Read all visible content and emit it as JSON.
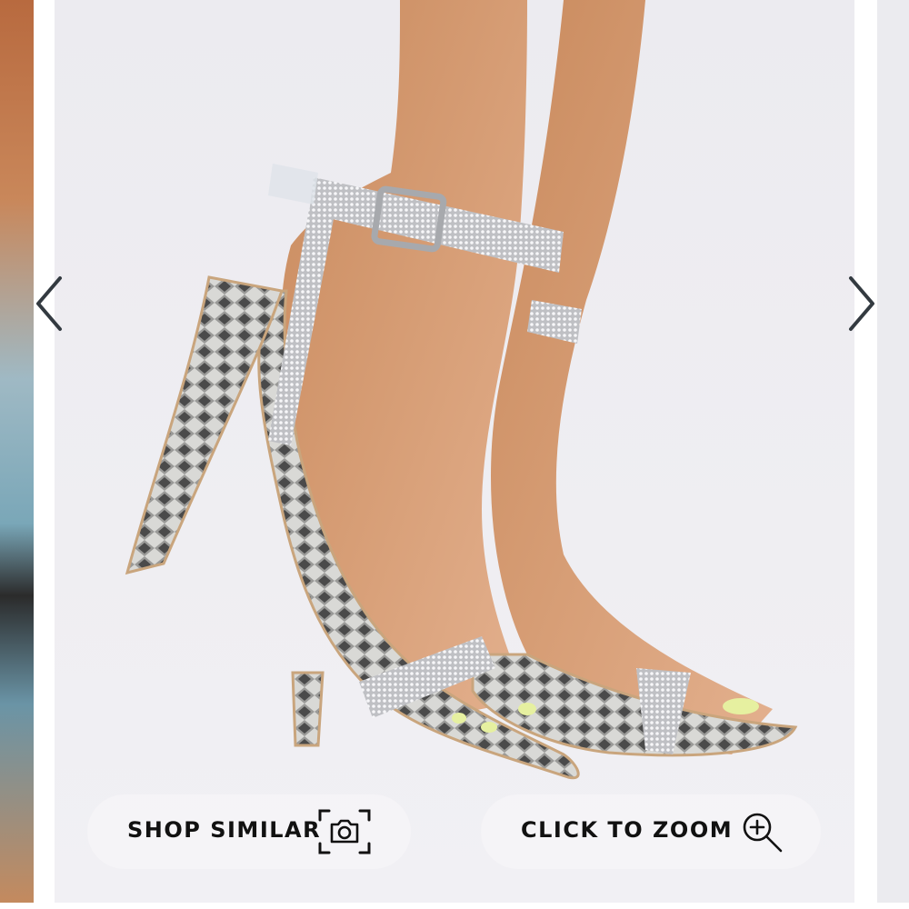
{
  "carousel": {
    "prev_label": "Previous image",
    "next_label": "Next image",
    "image_alt": "Snakeskin rhinestone strap high heel sandals"
  },
  "actions": {
    "shop_similar": {
      "label": "SHOP SIMILAR",
      "icon": "camera-icon"
    },
    "click_to_zoom": {
      "label": "CLICK TO ZOOM",
      "icon": "zoom-in-icon"
    }
  },
  "colors": {
    "pill_background": "#f4f3f6",
    "label_text": "#111111",
    "arrow": "#333a40"
  }
}
